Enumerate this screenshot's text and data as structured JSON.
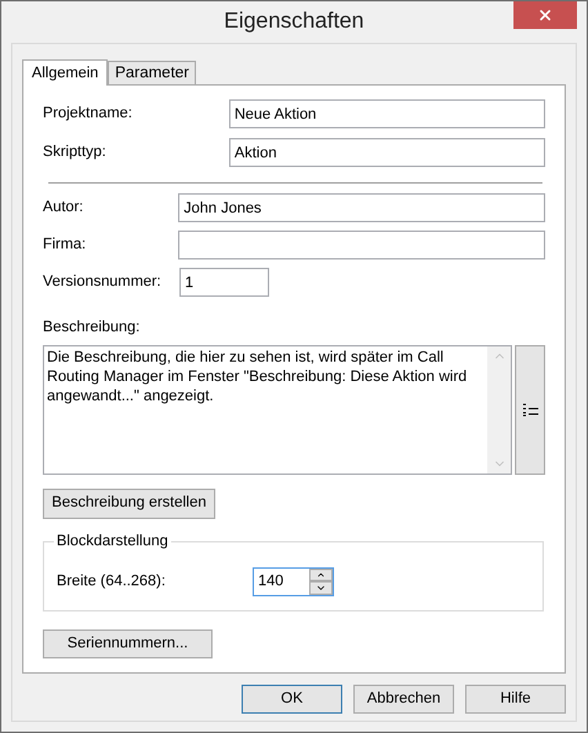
{
  "window": {
    "title": "Eigenschaften"
  },
  "tabs": [
    {
      "label": "Allgemein",
      "selected": true
    },
    {
      "label": "Parameter",
      "selected": false
    }
  ],
  "fields_top": [
    {
      "label": "Projektname:",
      "value": "Neue Aktion"
    },
    {
      "label": "Skripttyp:",
      "value": "Aktion"
    }
  ],
  "fields": [
    {
      "label": "Autor:",
      "value": "John Jones",
      "kind": "wide"
    },
    {
      "label": "Firma:",
      "kind": "wide"
    },
    {
      "label": "Versionsnummer:",
      "value": "1",
      "kind": "short"
    }
  ],
  "description": {
    "label": "Beschreibung:",
    "value": "Die Beschreibung, die hier zu sehen ist, wird später im Call Routing Manager im Fenster \"Beschreibung: Diese Aktion wird angewandt...\" angezeigt.",
    "create_button": "Beschreibung erstellen"
  },
  "block": {
    "title": "Blockdarstellung",
    "label": "Breite (64..268):",
    "value": "140"
  },
  "serial_button": "Seriennummern...",
  "buttons": [
    {
      "label": "OK",
      "default": true
    },
    {
      "label": "Abbrechen",
      "default": false
    },
    {
      "label": "Hilfe",
      "default": false
    }
  ]
}
